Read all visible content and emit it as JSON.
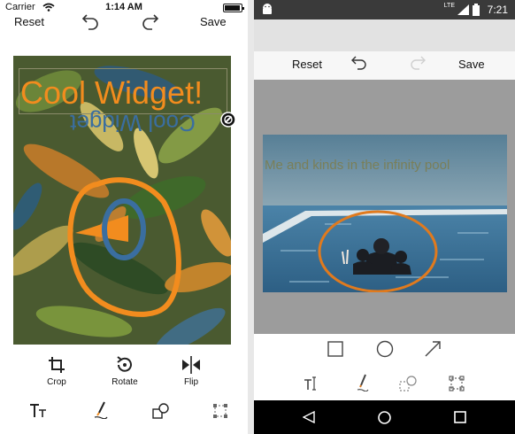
{
  "ios": {
    "status": {
      "carrier": "Carrier",
      "time": "1:14 AM"
    },
    "toolbar": {
      "reset_label": "Reset",
      "save_label": "Save"
    },
    "annotations": {
      "title_text": "Cool Widget!",
      "mirrored_text": "Cool Widget"
    },
    "tools": {
      "crop_label": "Crop",
      "rotate_label": "Rotate",
      "flip_label": "Flip"
    },
    "colors": {
      "accent_orange": "#f28c1e",
      "accent_blue": "#3a6ea0"
    }
  },
  "android": {
    "status": {
      "time": "7:21",
      "network": "LTE"
    },
    "toolbar": {
      "reset_label": "Reset",
      "save_label": "Save"
    },
    "annotations": {
      "caption": "Me and kinds in the infinity pool"
    },
    "tools": {
      "row1": [
        "rectangle-icon",
        "circle-icon",
        "arrow-icon"
      ],
      "row2": [
        "text-tool-icon",
        "pen-tool-icon",
        "shape-tool-icon",
        "selection-tool-icon"
      ]
    },
    "colors": {
      "accent_orange": "#e07a1e",
      "caption_color": "#7a7f58"
    }
  }
}
